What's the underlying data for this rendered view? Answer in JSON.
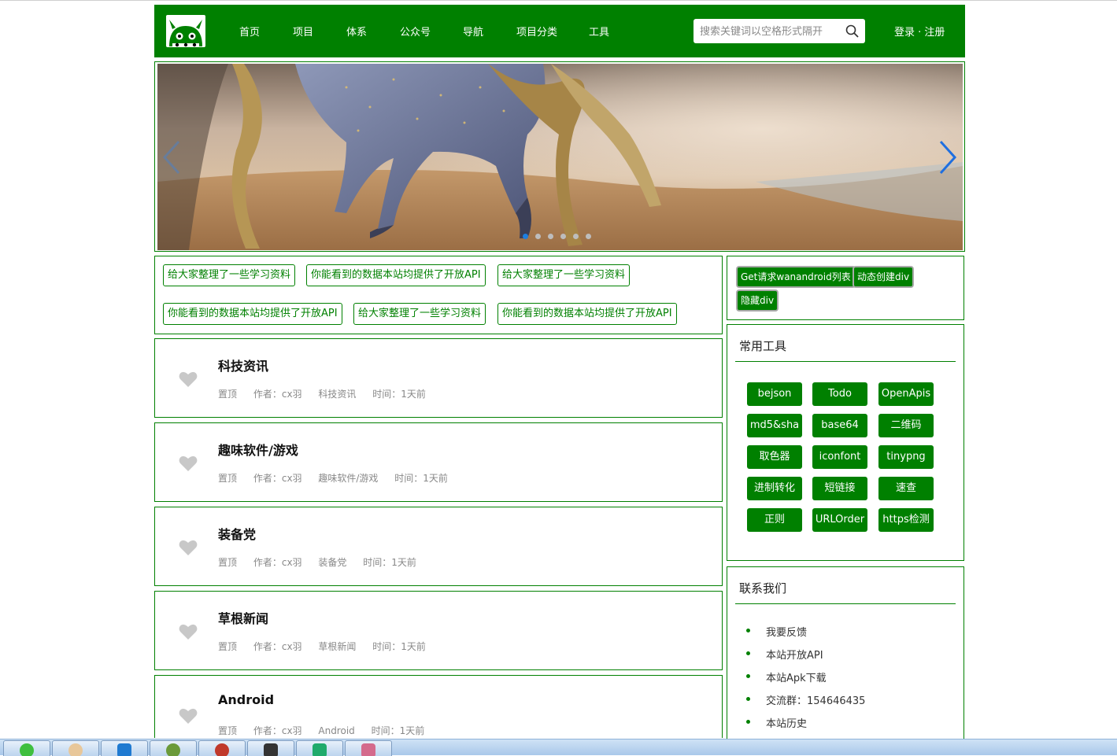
{
  "header": {
    "nav": [
      "首页",
      "项目",
      "体系",
      "公众号",
      "导航",
      "项目分类",
      "工具"
    ],
    "search_placeholder": "搜索关键词以空格形式隔开",
    "login": "登录 · 注册"
  },
  "banner": {
    "slide_count": 6,
    "active_slide": 1
  },
  "tags": [
    "给大家整理了一些学习资料",
    "你能看到的数据本站均提供了开放API",
    "给大家整理了一些学习资料",
    "你能看到的数据本站均提供了开放API",
    "给大家整理了一些学习资料",
    "你能看到的数据本站均提供了开放API"
  ],
  "articles": [
    {
      "title": "科技资讯",
      "pin": "置顶",
      "author": "作者：cx羽",
      "category": "科技资讯",
      "time": "时间：1天前"
    },
    {
      "title": "趣味软件/游戏",
      "pin": "置顶",
      "author": "作者：cx羽",
      "category": "趣味软件/游戏",
      "time": "时间：1天前"
    },
    {
      "title": "装备党",
      "pin": "置顶",
      "author": "作者：cx羽",
      "category": "装备党",
      "time": "时间：1天前"
    },
    {
      "title": "草根新闻",
      "pin": "置顶",
      "author": "作者：cx羽",
      "category": "草根新闻",
      "time": "时间：1天前"
    },
    {
      "title": "Android",
      "pin": "置顶",
      "author": "作者：cx羽",
      "category": "Android",
      "time": "时间：1天前"
    }
  ],
  "actions": [
    "Get请求wanandroid列表",
    "动态创建div",
    "隐藏div"
  ],
  "tools": {
    "title": "常用工具",
    "items": [
      "bejson",
      "Todo",
      "OpenApis",
      "md5&sha",
      "base64",
      "二维码",
      "取色器",
      "iconfont",
      "tinypng",
      "进制转化",
      "短链接",
      "速查",
      "正则",
      "URLOrder",
      "https检测"
    ]
  },
  "contact": {
    "title": "联系我们",
    "items": [
      "我要反馈",
      "本站开放API",
      "本站Apk下载",
      "交流群：154646435",
      "本站历史"
    ]
  },
  "colors": {
    "brand": "#008000",
    "dot_active": "#1e7fe0",
    "heart": "#c8c8c8"
  },
  "taskbar_icons": [
    "wechat-icon",
    "game-icon",
    "vscode-icon",
    "android-icon",
    "browser-icon",
    "terminal-icon",
    "pycharm-icon",
    "app-icon"
  ]
}
